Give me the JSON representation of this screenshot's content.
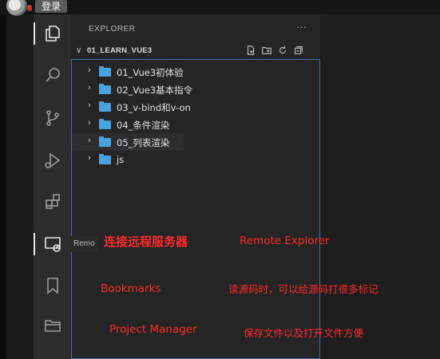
{
  "topbar": {
    "login_label": "登录"
  },
  "sidebar": {
    "title": "EXPLORER",
    "more": "···",
    "section": "01_LEARN_VUE3",
    "folders": [
      {
        "label": "01_Vue3初体验"
      },
      {
        "label": "02_Vue3基本指令"
      },
      {
        "label": "03_v-bind和v-on"
      },
      {
        "label": "04_条件渲染"
      },
      {
        "label": "05_列表渲染"
      },
      {
        "label": "js"
      }
    ]
  },
  "activity_icons": [
    "explorer-icon",
    "search-icon",
    "source-control-icon",
    "run-debug-icon",
    "extensions-icon",
    "remote-explorer-icon",
    "bookmarks-icon",
    "project-manager-icon"
  ],
  "tooltip": {
    "text": "Remo"
  },
  "annotations": {
    "remote_cn": "连接远程服务器",
    "remote_en": "Remote Explorer",
    "bookmarks_en": "Bookmarks",
    "bookmarks_cn": "读源码时，可以给源码打很多标记",
    "project_en": "Project Manager",
    "project_cn": "保存文件以及打开文件方便"
  },
  "colors": {
    "accent": "#3c6fb0",
    "folder": "#4aa3e0",
    "annotation": "#ff2a2a"
  }
}
